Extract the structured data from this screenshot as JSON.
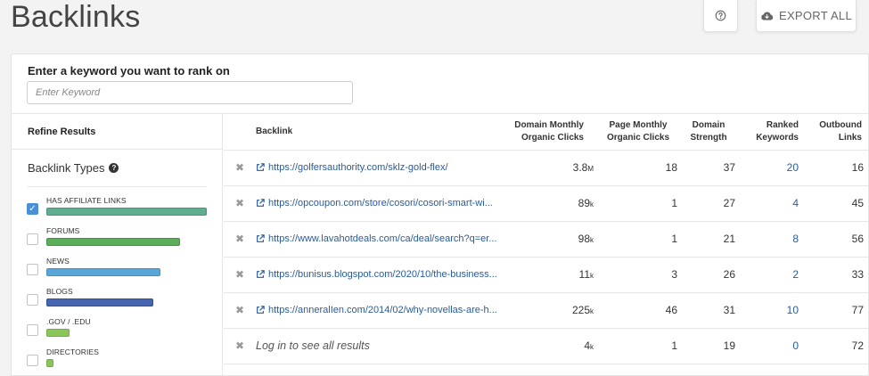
{
  "page": {
    "title": "Backlinks"
  },
  "toolbar": {
    "help_icon": "question-circle-icon",
    "export_label": "EXPORT ALL",
    "export_icon": "cloud-download-icon"
  },
  "search": {
    "label": "Enter a keyword you want to rank on",
    "placeholder": "Enter Keyword",
    "value": ""
  },
  "sidebar": {
    "refine_title": "Refine Results",
    "types_title": "Backlink Types",
    "types": [
      {
        "label": "HAS AFFILIATE LINKS",
        "checked": true,
        "bar_fraction": 1.0,
        "color": "#5fae8f"
      },
      {
        "label": "FORUMS",
        "checked": false,
        "bar_fraction": 0.83,
        "color": "#5cad5a"
      },
      {
        "label": "NEWS",
        "checked": false,
        "bar_fraction": 0.71,
        "color": "#5aa6d8"
      },
      {
        "label": "BLOGS",
        "checked": false,
        "bar_fraction": 0.66,
        "color": "#4565b0"
      },
      {
        "label": ".GOV / .EDU",
        "checked": false,
        "bar_fraction": 0.13,
        "color": "#8cc55a"
      },
      {
        "label": "DIRECTORIES",
        "checked": false,
        "bar_fraction": 0.04,
        "color": "#8cc55a"
      }
    ]
  },
  "table": {
    "headers": {
      "backlink": "Backlink",
      "domain_clicks_1": "Domain Monthly",
      "domain_clicks_2": "Organic Clicks",
      "page_clicks_1": "Page Monthly",
      "page_clicks_2": "Organic Clicks",
      "strength_1": "Domain",
      "strength_2": "Strength",
      "ranked_1": "Ranked",
      "ranked_2": "Keywords",
      "outbound_1": "Outbound",
      "outbound_2": "Links"
    },
    "rows": [
      {
        "url": "https://golfersauthority.com/sklz-gold-flex/",
        "domain_clicks": "3.8",
        "domain_unit": "M",
        "page_clicks": "18",
        "strength": "37",
        "ranked": "20",
        "outbound": "16"
      },
      {
        "url": "https://opcoupon.com/store/cosori/cosori-smart-wi...",
        "domain_clicks": "89",
        "domain_unit": "k",
        "page_clicks": "1",
        "strength": "27",
        "ranked": "4",
        "outbound": "45"
      },
      {
        "url": "https://www.lavahotdeals.com/ca/deal/search?q=er...",
        "domain_clicks": "98",
        "domain_unit": "k",
        "page_clicks": "1",
        "strength": "21",
        "ranked": "8",
        "outbound": "56"
      },
      {
        "url": "https://bunisus.blogspot.com/2020/10/the-business...",
        "domain_clicks": "11",
        "domain_unit": "k",
        "page_clicks": "3",
        "strength": "26",
        "ranked": "2",
        "outbound": "33"
      },
      {
        "url": "https://anneralIen.com/2014/02/why-novellas-are-h...",
        "domain_clicks": "225",
        "domain_unit": "k",
        "page_clicks": "46",
        "strength": "31",
        "ranked": "10",
        "outbound": "77"
      },
      {
        "login_text": "Log in to see all results",
        "domain_clicks": "4",
        "domain_unit": "k",
        "page_clicks": "1",
        "strength": "19",
        "ranked": "0",
        "outbound": "72"
      }
    ]
  }
}
